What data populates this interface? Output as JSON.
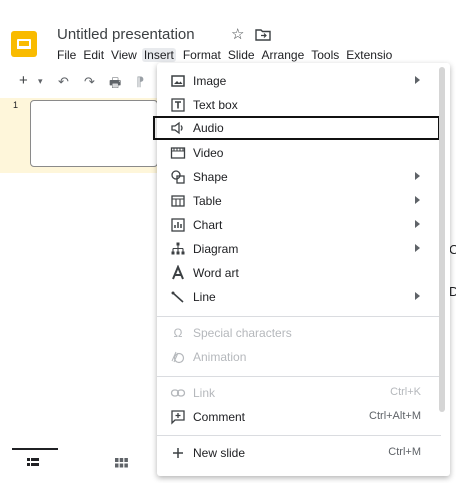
{
  "app": {
    "title": "Untitled presentation",
    "menus": [
      "File",
      "Edit",
      "View",
      "Insert",
      "Format",
      "Slide",
      "Arrange",
      "Tools",
      "Extensio"
    ],
    "active_menu": "Insert",
    "accent": "#f9bb00"
  },
  "toolbar": {
    "add": "+",
    "add_dropdown": "▾",
    "undo": "↶",
    "redo": "↷",
    "print": "🖶"
  },
  "filmstrip": {
    "slides": [
      {
        "number": "1"
      }
    ]
  },
  "insert_menu": {
    "items": [
      {
        "icon": "image-icon",
        "label": "Image",
        "submenu": true
      },
      {
        "icon": "text-box-icon",
        "label": "Text box"
      },
      {
        "icon": "audio-icon",
        "label": "Audio",
        "highlighted": true
      },
      {
        "icon": "video-icon",
        "label": "Video"
      },
      {
        "icon": "shape-icon",
        "label": "Shape",
        "submenu": true
      },
      {
        "icon": "table-icon",
        "label": "Table",
        "submenu": true
      },
      {
        "icon": "chart-icon",
        "label": "Chart",
        "submenu": true
      },
      {
        "icon": "diagram-icon",
        "label": "Diagram",
        "submenu": true
      },
      {
        "icon": "word-art-icon",
        "label": "Word art"
      },
      {
        "icon": "line-icon",
        "label": "Line",
        "submenu": true
      },
      {
        "icon": "omega-icon",
        "label": "Special characters",
        "disabled": true
      },
      {
        "icon": "animation-icon",
        "label": "Animation",
        "disabled": true
      },
      {
        "icon": "link-icon",
        "label": "Link",
        "shortcut": "Ctrl+K",
        "disabled": true
      },
      {
        "icon": "comment-icon",
        "label": "Comment",
        "shortcut": "Ctrl+Alt+M"
      },
      {
        "icon": "plus-icon",
        "label": "New slide",
        "shortcut": "Ctrl+M"
      }
    ]
  },
  "right_peek": {
    "a": "C",
    "b": "D"
  }
}
